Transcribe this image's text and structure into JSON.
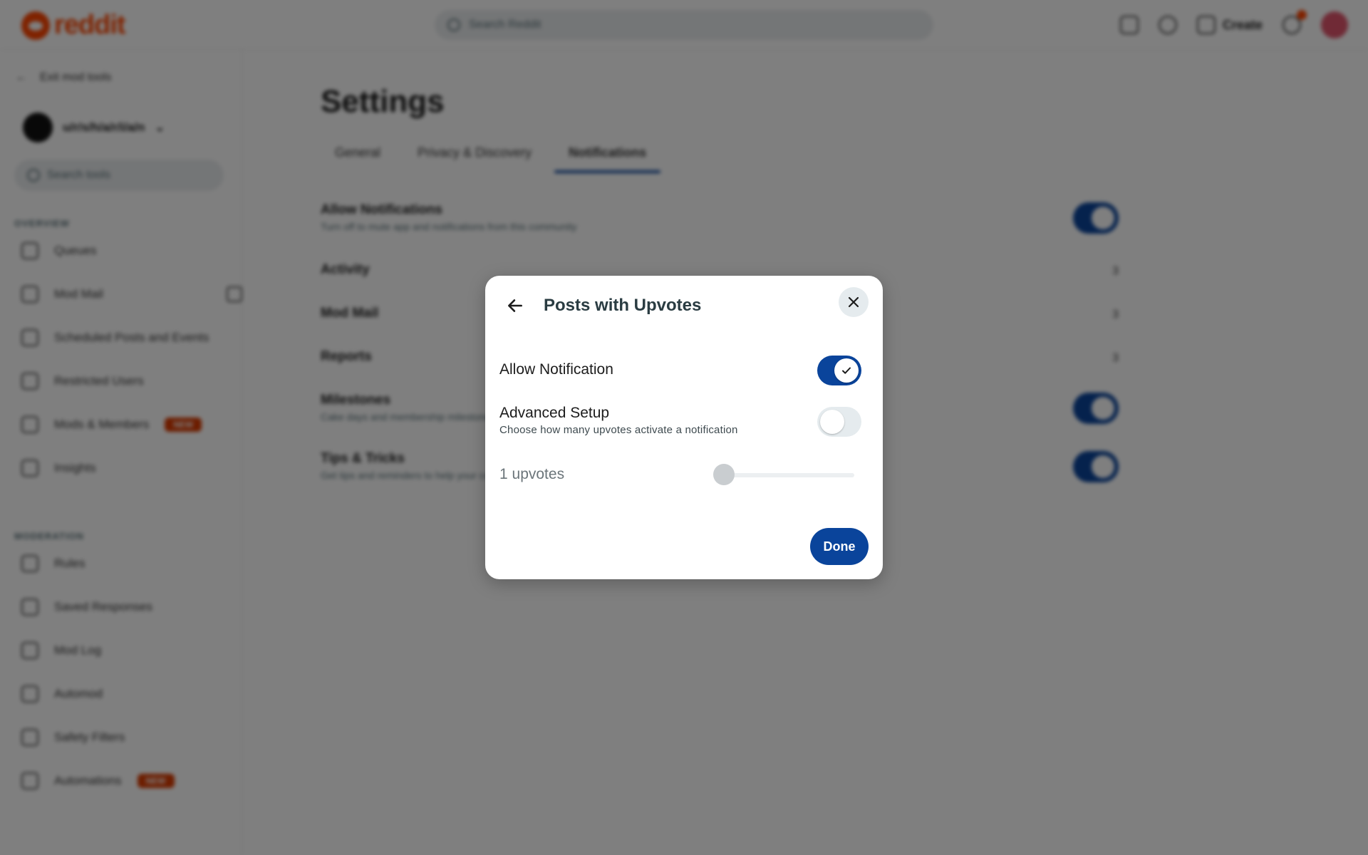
{
  "topbar": {
    "logo_text": "reddit",
    "search_placeholder": "Search Reddit",
    "create_label": "Create"
  },
  "sidebar": {
    "back_label": "Exit mod tools",
    "subreddit_name": "u/r/s/h/a/r/i/a/n",
    "search_placeholder": "Search tools",
    "sections": [
      {
        "title": "OVERVIEW",
        "items": [
          {
            "label": "Queues",
            "icon": "queue-icon"
          },
          {
            "label": "Mod Mail",
            "icon": "mail-icon"
          },
          {
            "label": "Scheduled Posts and Events",
            "icon": "calendar-icon"
          },
          {
            "label": "Restricted Users",
            "icon": "restricted-icon"
          },
          {
            "label": "Mods & Members",
            "icon": "members-icon",
            "badge": "NEW"
          },
          {
            "label": "Insights",
            "icon": "insights-icon"
          }
        ]
      },
      {
        "title": "MODERATION",
        "items": [
          {
            "label": "Rules",
            "icon": "rules-icon"
          },
          {
            "label": "Saved Responses",
            "icon": "responses-icon"
          },
          {
            "label": "Mod Log",
            "icon": "log-icon"
          },
          {
            "label": "Automod",
            "icon": "automod-icon"
          },
          {
            "label": "Safety Filters",
            "icon": "filter-icon"
          },
          {
            "label": "Automations",
            "icon": "automations-icon",
            "badge": "NEW"
          }
        ]
      }
    ]
  },
  "main": {
    "title": "Settings",
    "tabs": [
      {
        "label": "General",
        "active": false
      },
      {
        "label": "Privacy & Discovery",
        "active": false
      },
      {
        "label": "Notifications",
        "active": true
      }
    ],
    "settings": [
      {
        "label": "Allow Notifications",
        "desc": "Turn off to mute app and notifications from this community",
        "control": "toggle-on"
      },
      {
        "label": "Activity",
        "value": "3",
        "control": "value"
      },
      {
        "label": "Mod Mail",
        "value": "3",
        "control": "value"
      },
      {
        "label": "Reports",
        "value": "3",
        "control": "value"
      },
      {
        "label": "Milestones",
        "desc": "Cake days and membership milestones",
        "control": "toggle-on"
      },
      {
        "label": "Tips & Tricks",
        "desc": "Get tips and reminders to help your community grow",
        "control": "toggle-on"
      }
    ]
  },
  "modal": {
    "title": "Posts with Upvotes",
    "allow_notification": {
      "label": "Allow Notification",
      "enabled": true
    },
    "advanced_setup": {
      "label": "Advanced Setup",
      "sub": "Choose how many upvotes activate a notification",
      "enabled": false
    },
    "slider": {
      "label": "1 upvotes",
      "value": 1,
      "disabled": true
    },
    "done_label": "Done",
    "accent_color": "#0a449b",
    "icons": {
      "back": "arrow-left-icon",
      "close": "close-icon",
      "check": "checkmark-icon"
    }
  }
}
